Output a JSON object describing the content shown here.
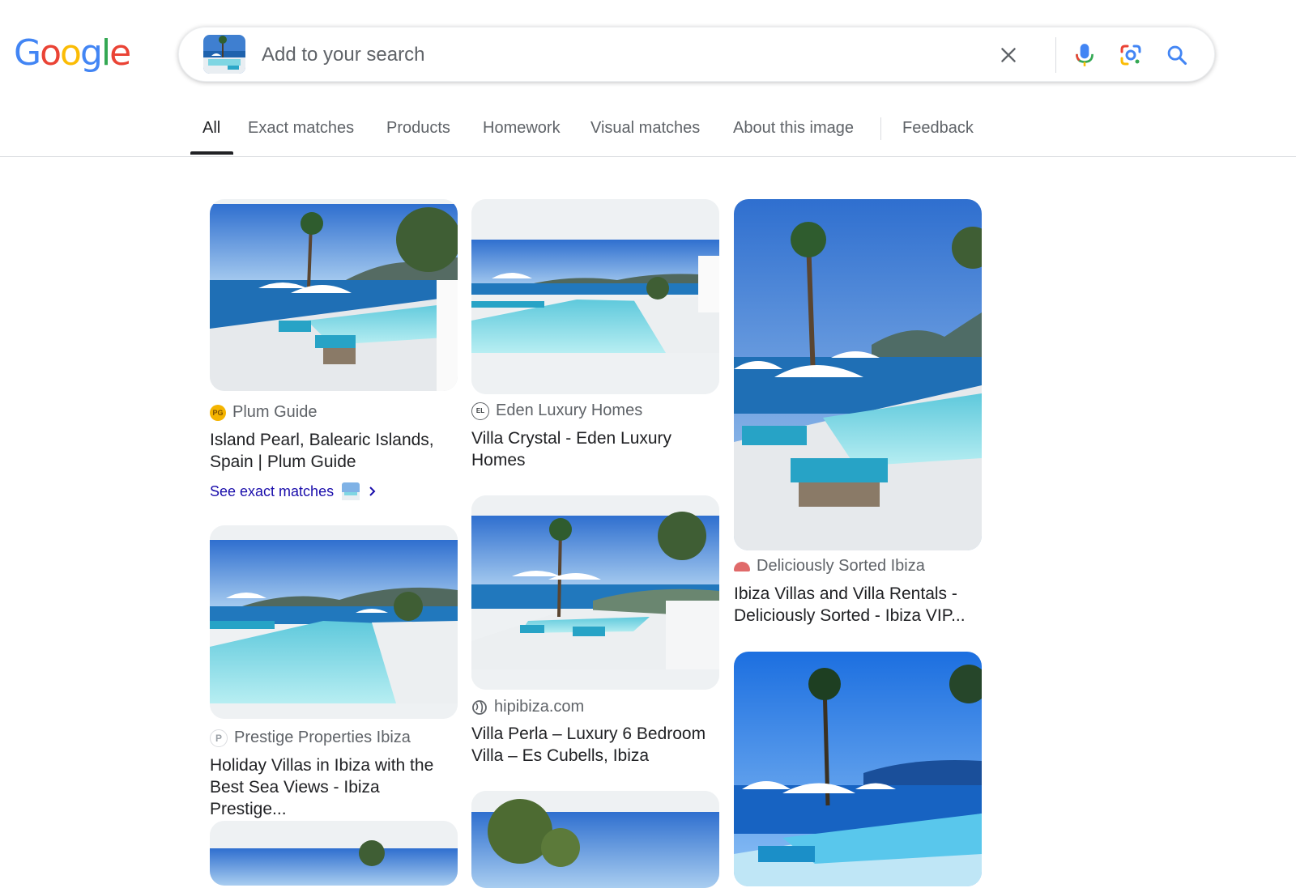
{
  "header": {
    "logo_letters": [
      {
        "ch": "G",
        "color": "#4285F4"
      },
      {
        "ch": "o",
        "color": "#EA4335"
      },
      {
        "ch": "o",
        "color": "#FBBC05"
      },
      {
        "ch": "g",
        "color": "#4285F4"
      },
      {
        "ch": "l",
        "color": "#34A853"
      },
      {
        "ch": "e",
        "color": "#EA4335"
      }
    ],
    "search": {
      "placeholder": "Add to your search",
      "value": "",
      "clear_icon": "close-icon",
      "mic_icon": "microphone-icon",
      "lens_icon": "camera-lens-icon",
      "search_icon": "search-icon"
    }
  },
  "tabs": [
    {
      "label": "All",
      "active": true
    },
    {
      "label": "Exact matches",
      "active": false
    },
    {
      "label": "Products",
      "active": false
    },
    {
      "label": "Homework",
      "active": false
    },
    {
      "label": "Visual matches",
      "active": false
    },
    {
      "label": "About this image",
      "active": false
    },
    {
      "label": "Feedback",
      "active": false
    }
  ],
  "results": [
    {
      "source": "Plum Guide",
      "favicon_text": "PG",
      "favicon_color": "#f4b400",
      "title": "Island Pearl, Balearic Islands, Spain | Plum Guide",
      "see_exact_label": "See exact matches"
    },
    {
      "source": "Eden Luxury Homes",
      "favicon_text": "EL",
      "favicon_color": "#5f6368",
      "title": "Villa Crystal - Eden Luxury Homes"
    },
    {
      "source": "Deliciously Sorted Ibiza",
      "favicon_text": "",
      "favicon_color": "#e06a6a",
      "title": "Ibiza Villas and Villa Rentals - Deliciously Sorted - Ibiza VIP..."
    },
    {
      "source": "Prestige Properties Ibiza",
      "favicon_text": "P",
      "favicon_color": "#9aa0a6",
      "title": "Holiday Villas in Ibiza with the Best Sea Views - Ibiza Prestige..."
    },
    {
      "source": "hipibiza.com",
      "favicon_text": "globe-icon",
      "favicon_color": "#5f6368",
      "title": "Villa Perla – Luxury 6 Bedroom Villa – Es Cubells, Ibiza"
    },
    {
      "source": "",
      "title": ""
    },
    {
      "source": "",
      "title": ""
    },
    {
      "source": "",
      "title": ""
    }
  ],
  "colors": {
    "link": "#1a0dab",
    "sky": "#4a86d4",
    "sea": "#1e6fb3",
    "pool": "#7fd6e3",
    "lounger": "#2aa6c8"
  }
}
